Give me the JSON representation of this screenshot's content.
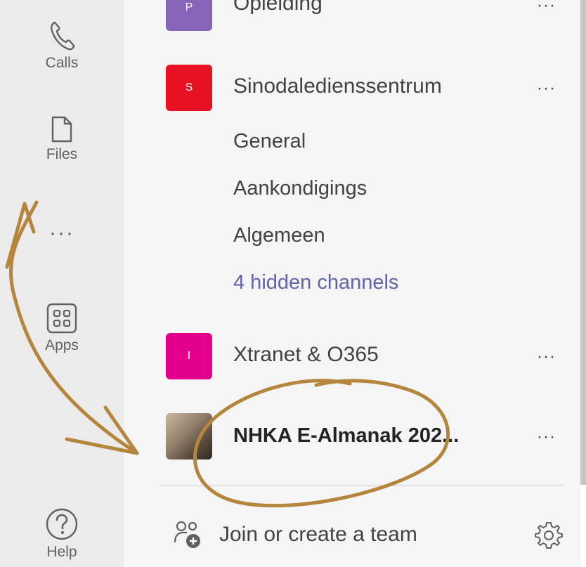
{
  "rail": {
    "calls": {
      "label": "Calls",
      "icon": "phone-icon"
    },
    "files": {
      "label": "Files",
      "icon": "file-icon"
    },
    "more": {
      "label": "···"
    },
    "apps": {
      "label": "Apps",
      "icon": "apps-grid-icon"
    },
    "help": {
      "label": "Help",
      "icon": "help-icon"
    }
  },
  "teams": [
    {
      "name": "Opleiding",
      "avatar_letter": "P",
      "color": "#8764b8"
    },
    {
      "name": "Sinodaledienssentrum",
      "avatar_letter": "S",
      "color": "#e81123",
      "channels": [
        "General",
        "Aankondigings",
        "Algemeen"
      ],
      "hidden_channels": "4 hidden channels"
    },
    {
      "name": "Xtranet & O365",
      "avatar_letter": "I",
      "color": "#e3008c"
    },
    {
      "name": "NHKA E-Almanak 202...",
      "avatar_letter": "",
      "color": "#9a8a7a"
    }
  ],
  "team_more_label": "···",
  "footer": {
    "join_label": "Join or create a team",
    "join_icon": "people-add-icon",
    "settings_icon": "gear-icon"
  },
  "annotation_color": "#b5853d"
}
